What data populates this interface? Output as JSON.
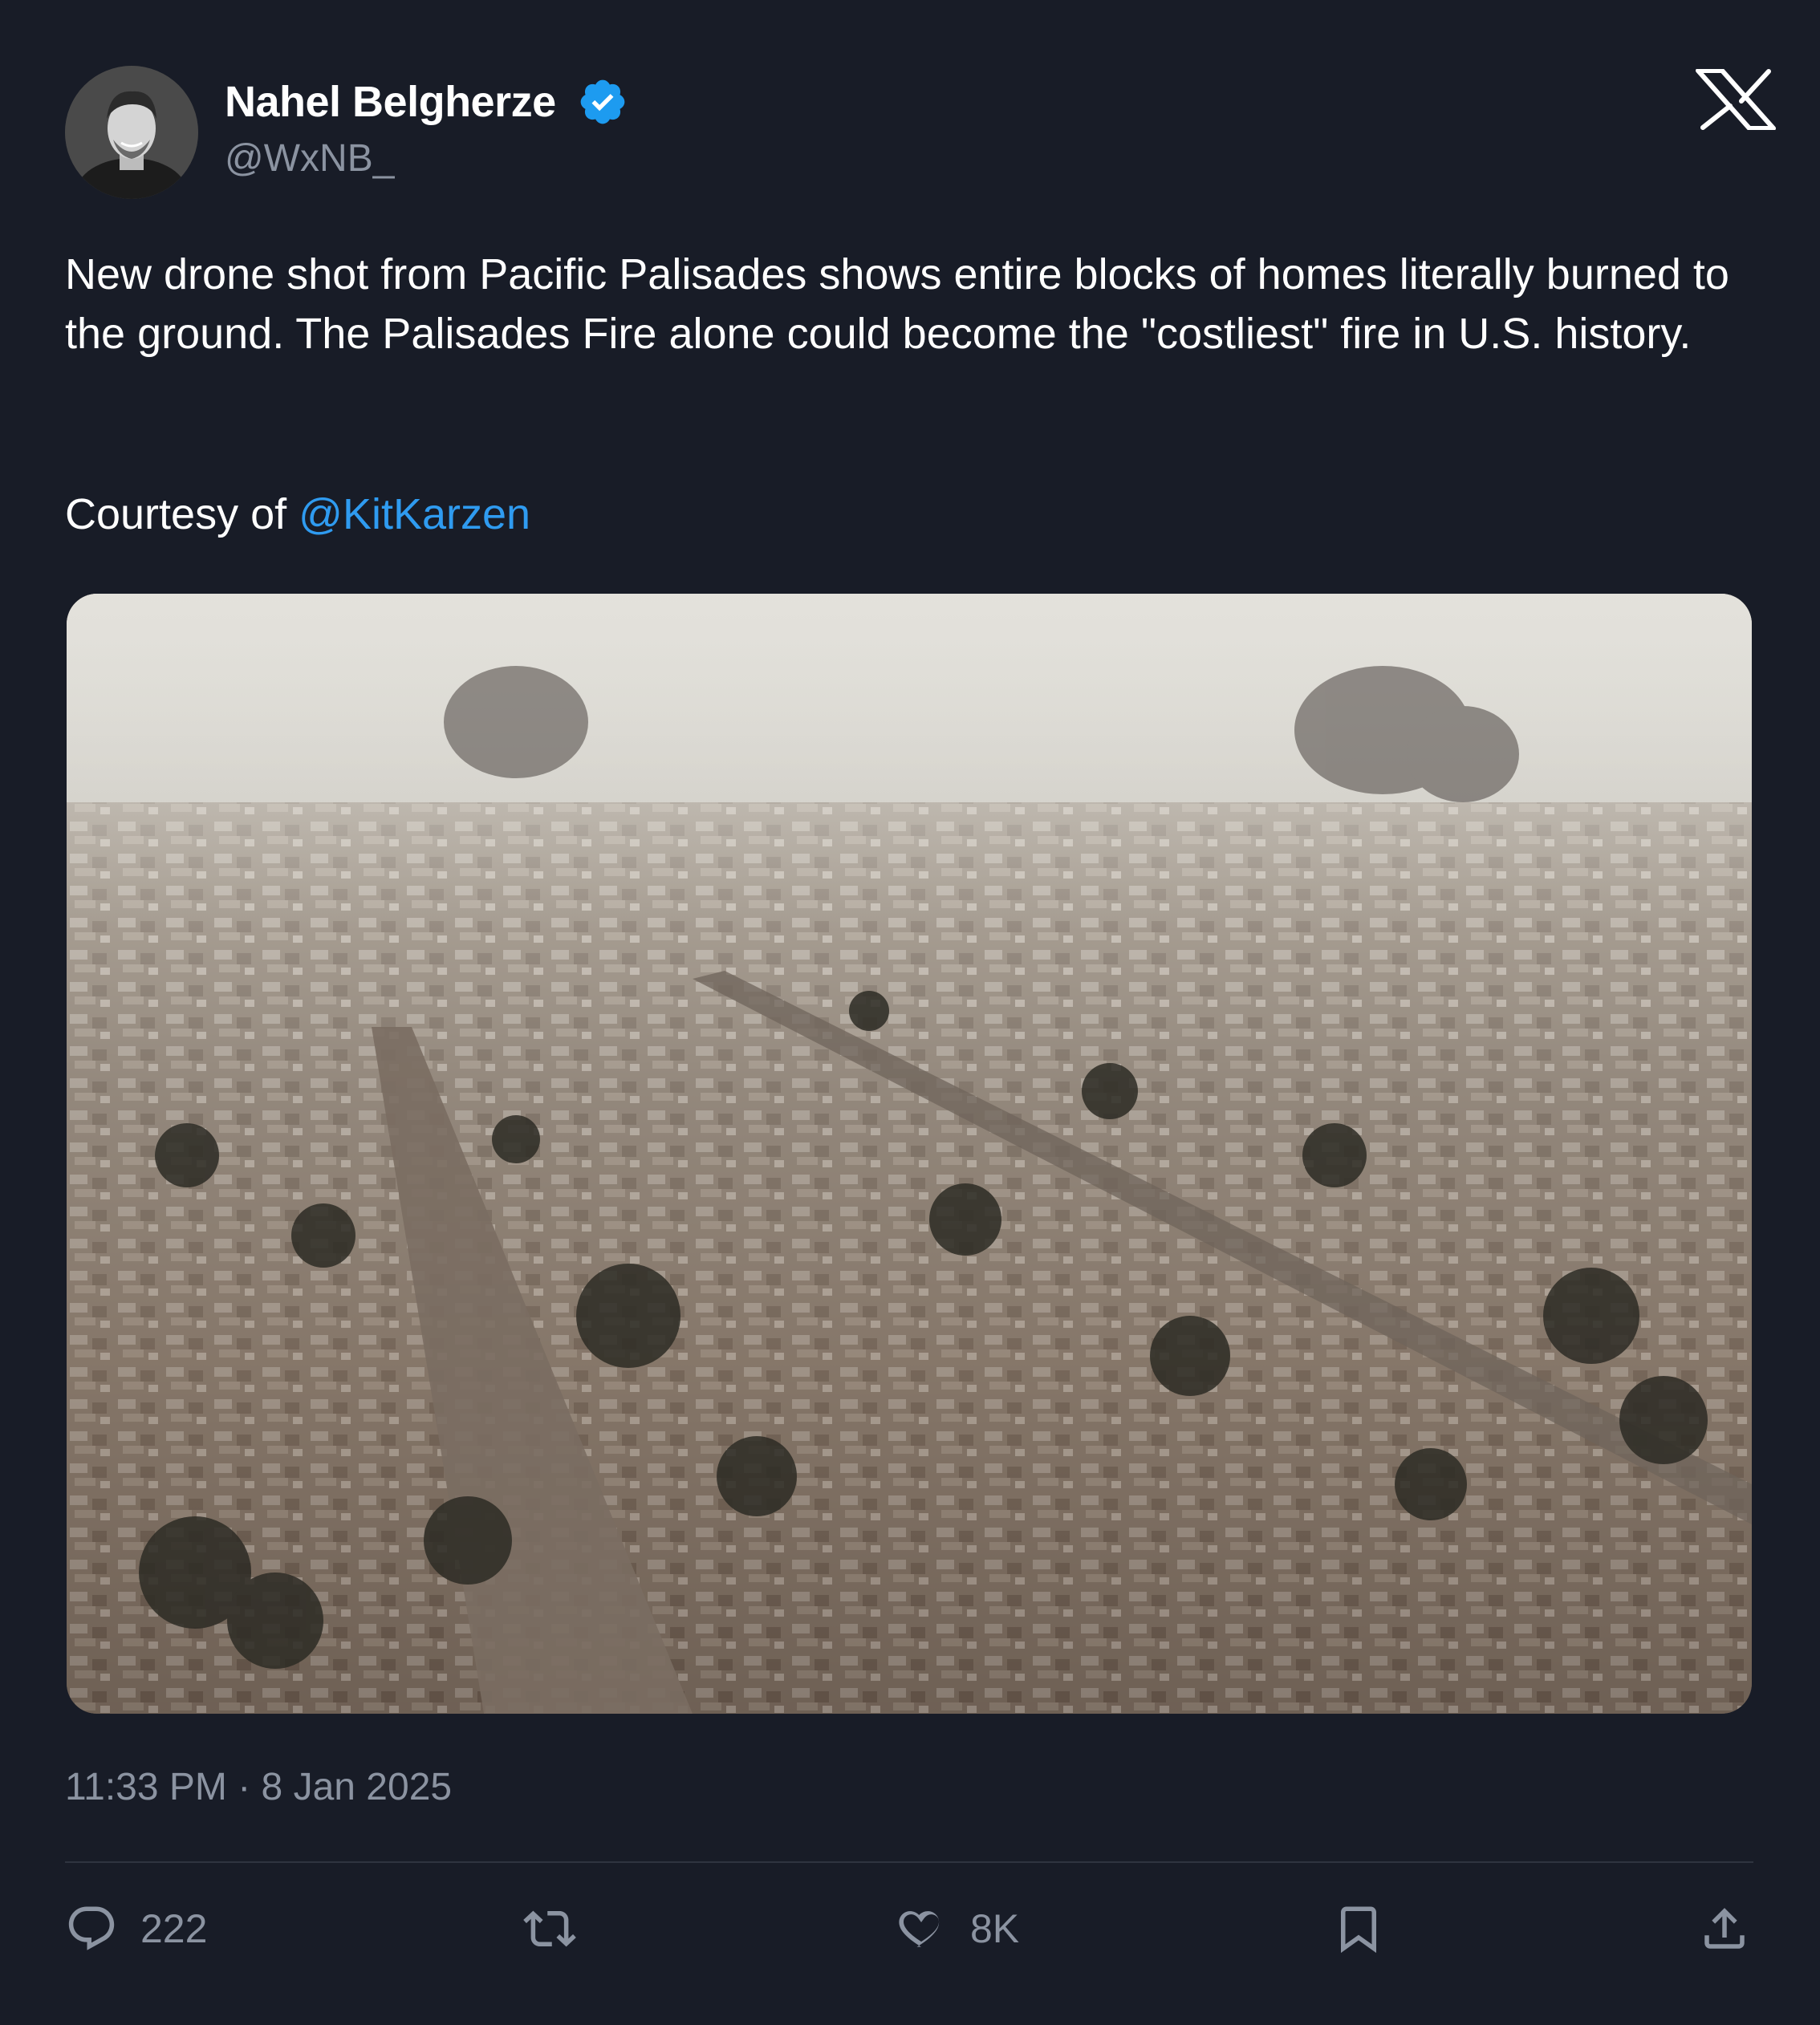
{
  "author": {
    "name": "Nahel Belgherze",
    "handle": "@WxNB_",
    "verified_color": "#1d9bf0"
  },
  "platform_logo": "x-logo-icon",
  "tweet": {
    "text": "New drone shot from Pacific Palisades shows entire blocks of homes literally burned to the ground. The Palisades Fire alone could become the \"costliest\" fire in U.S. history.",
    "courtesy_prefix": "Courtesy of ",
    "courtesy_mention": "@KitKarzen",
    "mention_color": "#2f9bf0"
  },
  "timestamp": "11:33 PM · 8 Jan 2025",
  "actions": {
    "reply": {
      "icon": "reply-icon",
      "count": "222"
    },
    "retweet": {
      "icon": "retweet-icon"
    },
    "like": {
      "icon": "heart-icon",
      "count": "8K"
    },
    "bookmark": {
      "icon": "bookmark-icon"
    },
    "share": {
      "icon": "share-icon"
    }
  },
  "colors": {
    "background": "#181c27",
    "muted": "#8b93a1",
    "text": "#ffffff"
  }
}
